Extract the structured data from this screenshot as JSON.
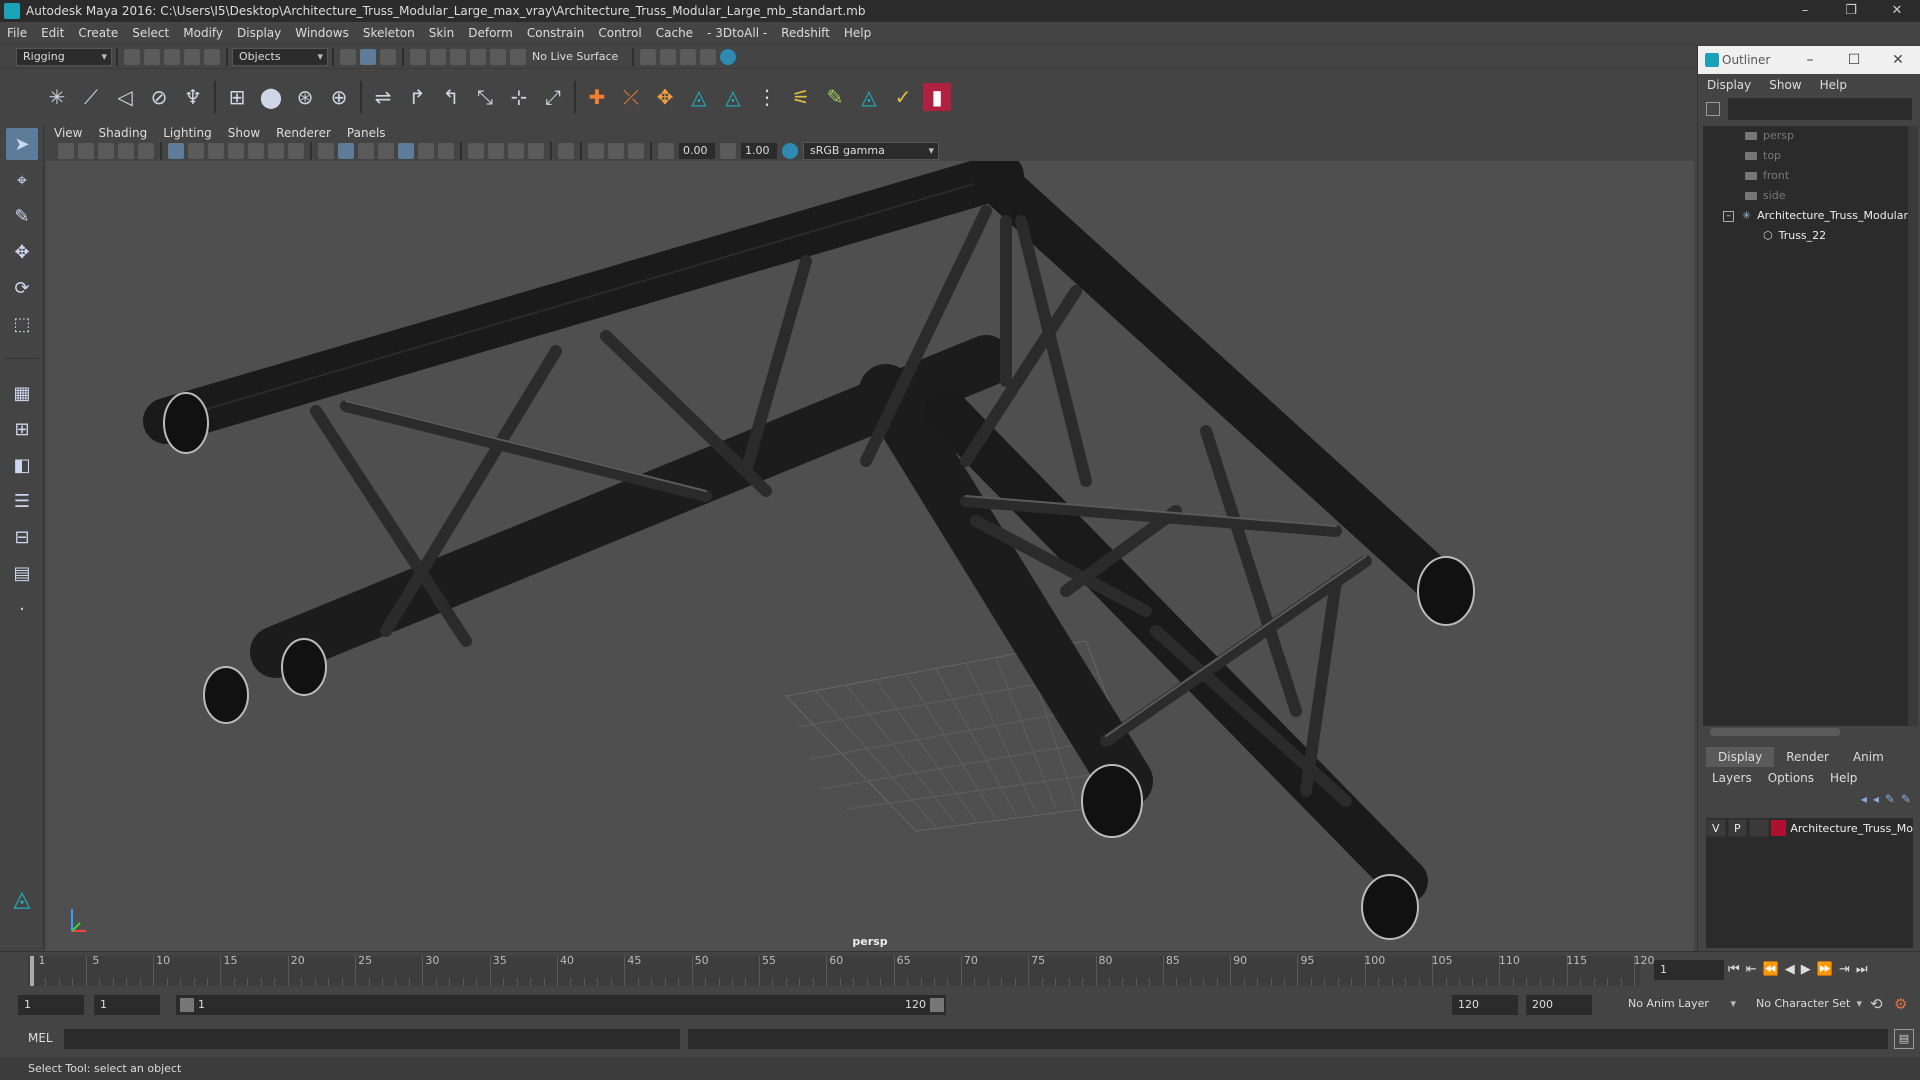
{
  "window": {
    "title": "Autodesk Maya 2016: C:\\Users\\I5\\Desktop\\Architecture_Truss_Modular_Large_max_vray\\Architecture_Truss_Modular_Large_mb_standart.mb",
    "minimize": "–",
    "maximize": "❐",
    "close": "✕"
  },
  "menubar": [
    "File",
    "Edit",
    "Create",
    "Select",
    "Modify",
    "Display",
    "Windows",
    "Skeleton",
    "Skin",
    "Deform",
    "Constrain",
    "Control",
    "Cache",
    "- 3DtoAll -",
    "Redshift",
    "Help"
  ],
  "statusline": {
    "mode": "Rigging",
    "selection_mode": "Objects",
    "live_surface": "No Live Surface"
  },
  "viewport": {
    "menu": [
      "View",
      "Shading",
      "Lighting",
      "Show",
      "Renderer",
      "Panels"
    ],
    "near": "0.00",
    "far": "1.00",
    "color_space": "sRGB gamma",
    "camera_label": "persp"
  },
  "outliner": {
    "title": "Outliner",
    "menu": [
      "Display",
      "Show",
      "Help"
    ],
    "items": [
      {
        "label": "persp",
        "kind": "camera"
      },
      {
        "label": "top",
        "kind": "camera"
      },
      {
        "label": "front",
        "kind": "camera"
      },
      {
        "label": "side",
        "kind": "camera"
      },
      {
        "label": "Architecture_Truss_Modular",
        "kind": "group"
      },
      {
        "label": "Truss_22",
        "kind": "mesh"
      }
    ]
  },
  "layers": {
    "tabs": [
      "Display",
      "Render",
      "Anim"
    ],
    "menu": [
      "Layers",
      "Options",
      "Help"
    ],
    "rows": [
      {
        "v": "V",
        "p": "P",
        "name": "Architecture_Truss_Mo",
        "color": "#b01030"
      }
    ]
  },
  "timeline": {
    "ticks": [
      "1",
      "5",
      "10",
      "15",
      "20",
      "25",
      "30",
      "35",
      "40",
      "45",
      "50",
      "55",
      "60",
      "65",
      "70",
      "75",
      "80",
      "85",
      "90",
      "95",
      "100",
      "105",
      "110",
      "115",
      "120"
    ],
    "current_frame": "1"
  },
  "range": {
    "start": "1",
    "playback_start": "1",
    "slider_start": "1",
    "slider_end": "120",
    "playback_end": "120",
    "end": "200",
    "anim_layer": "No Anim Layer",
    "character_set": "No Character Set"
  },
  "cmdline": {
    "language": "MEL"
  },
  "helpline": {
    "text": "Select Tool: select an object"
  }
}
